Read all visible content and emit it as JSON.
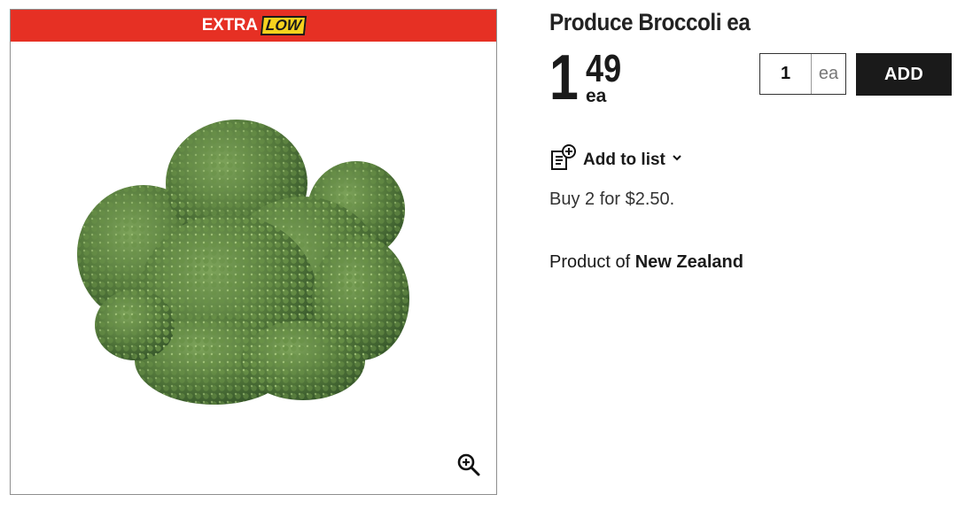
{
  "promo": {
    "extra_label": "EXTRA",
    "low_label": "LOW"
  },
  "product": {
    "title": "Produce Broccoli ea",
    "price_dollars": "1",
    "price_cents": "49",
    "price_unit": "ea",
    "image_alt": "broccoli"
  },
  "quantity": {
    "value": "1",
    "unit": "ea"
  },
  "buttons": {
    "add_label": "ADD",
    "add_to_list_label": "Add to list"
  },
  "promo_text": "Buy 2 for $2.50.",
  "origin": {
    "prefix": "Product of",
    "country": "New Zealand"
  },
  "icons": {
    "zoom": "zoom-in-icon",
    "list_add": "list-add-icon",
    "chevron": "chevron-down-icon"
  },
  "colors": {
    "promo_red": "#e63024",
    "promo_yellow": "#f6d21e",
    "button_dark": "#1a1a1a"
  }
}
